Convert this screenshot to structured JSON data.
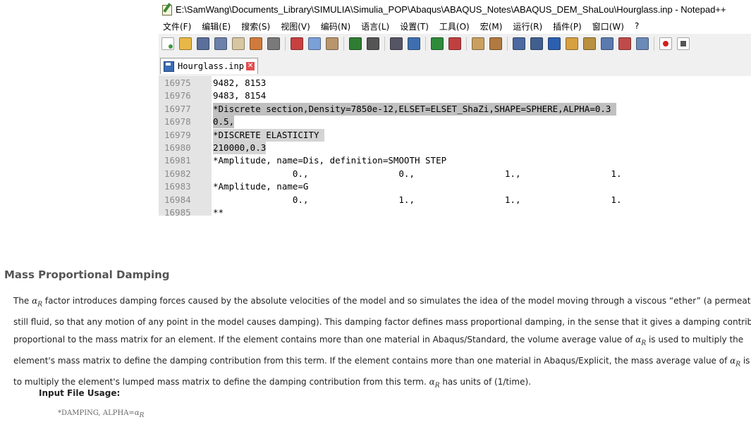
{
  "window": {
    "title": "E:\\SamWang\\Documents_Library\\SIMULIA\\Simulia_POP\\Abaqus\\ABAQUS_Notes\\ABAQUS_DEM_ShaLou\\Hourglass.inp - Notepad++"
  },
  "menu": [
    "文件(F)",
    "编辑(E)",
    "搜索(S)",
    "视图(V)",
    "编码(N)",
    "语言(L)",
    "设置(T)",
    "工具(O)",
    "宏(M)",
    "运行(R)",
    "插件(P)",
    "窗口(W)",
    "?"
  ],
  "toolbar": {
    "icons": [
      "new-file-icon",
      "open-file-icon",
      "save-icon",
      "save-all-icon",
      "close-icon",
      "close-all-icon",
      "print-icon",
      "|",
      "cut-icon",
      "copy-icon",
      "paste-icon",
      "|",
      "undo-icon",
      "redo-icon",
      "|",
      "find-icon",
      "replace-icon",
      "|",
      "zoom-in-icon",
      "zoom-out-icon",
      "|",
      "sync-vertical-icon",
      "sync-horizontal-icon",
      "|",
      "word-wrap-icon",
      "show-all-chars-icon",
      "indent-guide-icon",
      "document-map-icon",
      "function-list-icon",
      "folder-workspace-icon",
      "monitor-icon",
      "eye-icon",
      "|",
      "record-macro-icon",
      "stop-macro-icon"
    ],
    "colors": {
      "new-file-icon": "#ffffff",
      "open-file-icon": "#e8b847",
      "save-icon": "#5a6f9a",
      "save-all-icon": "#6b80aa",
      "close-icon": "#d8c6a0",
      "close-all-icon": "#d07b3c",
      "print-icon": "#7a7a7a",
      "cut-icon": "#c84040",
      "copy-icon": "#7aa0d8",
      "paste-icon": "#b8956a",
      "undo-icon": "#2f7d32",
      "redo-icon": "#555555",
      "find-icon": "#555566",
      "replace-icon": "#3f6fb0",
      "zoom-in-icon": "#2e8b3a",
      "zoom-out-icon": "#c04040",
      "sync-vertical-icon": "#c9a060",
      "sync-horizontal-icon": "#b07a40",
      "word-wrap-icon": "#4a6aa0",
      "show-all-chars-icon": "#3f5f8f",
      "indent-guide-icon": "#2c5fb0",
      "document-map-icon": "#d8a040",
      "function-list-icon": "#b89040",
      "folder-workspace-icon": "#5a7ab0",
      "monitor-icon": "#c04a4a",
      "eye-icon": "#6a8ab8",
      "record-macro-icon": "#d02020",
      "stop-macro-icon": "#555555"
    }
  },
  "tab": {
    "label": "Hourglass.inp"
  },
  "editor": {
    "lines": [
      {
        "n": "16975",
        "text": "9482, 8153",
        "hl": ""
      },
      {
        "n": "16976",
        "text": "9483, 8154",
        "hl": ""
      },
      {
        "n": "16977",
        "text": "*Discrete section,Density=7850e-12,ELSET=ELSET_ShaZi,SHAPE=SPHERE,ALPHA=0.3 ",
        "hl": "hl"
      },
      {
        "n": "16978",
        "text": "0.5,",
        "hl": "hl"
      },
      {
        "n": "16979",
        "text": "*DISCRETE ELASTICITY ",
        "hl": "hl-light"
      },
      {
        "n": "16980",
        "text": "210000,0.3",
        "hl": "hl-light"
      },
      {
        "n": "16981",
        "text": "*Amplitude, name=Dis, definition=SMOOTH STEP",
        "hl": ""
      },
      {
        "n": "16982",
        "text": "               0.,                 0.,                 1.,                 1.",
        "hl": ""
      },
      {
        "n": "16983",
        "text": "*Amplitude, name=G",
        "hl": ""
      },
      {
        "n": "16984",
        "text": "               0.,                 1.,                 1.,                 1.",
        "hl": ""
      },
      {
        "n": "16985",
        "text": "**",
        "hl": ""
      }
    ]
  },
  "doc": {
    "heading": "Mass Proportional Damping",
    "alpha_symbol": "α",
    "alpha_sub": "R",
    "p1": "The ",
    "p1b": " factor introduces damping forces caused by the absolute velocities of the model and so simulates the idea of the model moving through a viscous “ether” (a permeating,",
    "p2": "still fluid, so that any motion of any point in the model causes damping). This damping factor defines mass proportional damping, in the sense that it gives a damping contribution",
    "p3": "proportional to the mass matrix for an element. If the element contains more than one material in Abaqus/Standard, the volume average value of ",
    "p3b": " is used to multiply the",
    "p4": "element's mass matrix to define the damping contribution from this term. If the element contains more than one material in Abaqus/Explicit, the mass average value of ",
    "p4b": " is used",
    "p5": "to multiply the element's lumped mass matrix to define the damping contribution from this term. ",
    "p5b": " has units of (1/time).",
    "usage_label": "Input File Usage:",
    "usage_code": "*DAMPING, ALPHA="
  }
}
